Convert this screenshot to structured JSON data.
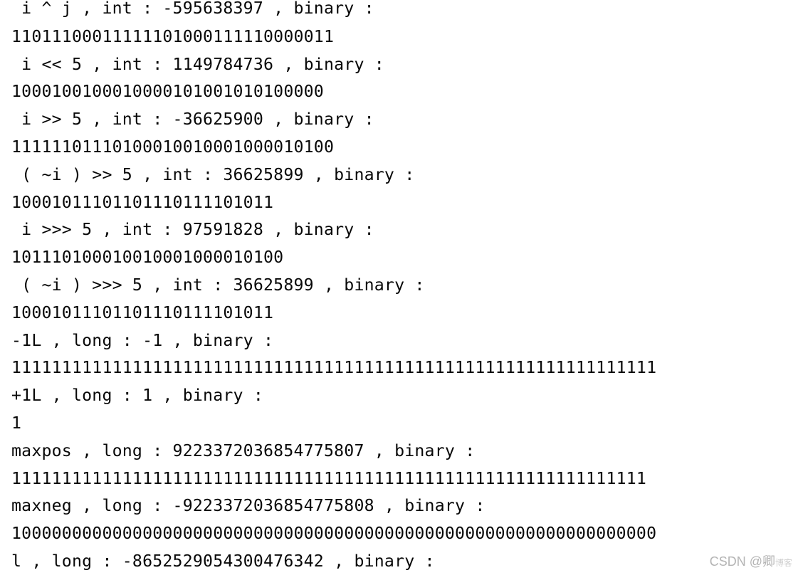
{
  "lines": [
    " i ^ j , int : -595638397 , binary :",
    "11011100011111101000111110000011",
    " i << 5 , int : 1149784736 , binary :",
    "1000100100010000101001010100000",
    " i >> 5 , int : -36625900 , binary :",
    "11111101110100010010001000010100",
    " ( ~i ) >> 5 , int : 36625899 , binary :",
    "10001011101101110111101011",
    " i >>> 5 , int : 97591828 , binary :",
    "101110100010010001000010100",
    " ( ~i ) >>> 5 , int : 36625899 , binary :",
    "10001011101101110111101011",
    "-1L , long : -1 , binary :",
    "1111111111111111111111111111111111111111111111111111111111111111",
    "+1L , long : 1 , binary :",
    "1",
    "maxpos , long : 9223372036854775807 , binary :",
    "111111111111111111111111111111111111111111111111111111111111111",
    "maxneg , long : -9223372036854775808 , binary :",
    "1000000000000000000000000000000000000000000000000000000000000000",
    "l , long : -8652529054300476342 , binary :"
  ],
  "watermark": {
    "main": "CSDN @卿",
    "faint": "博客"
  }
}
